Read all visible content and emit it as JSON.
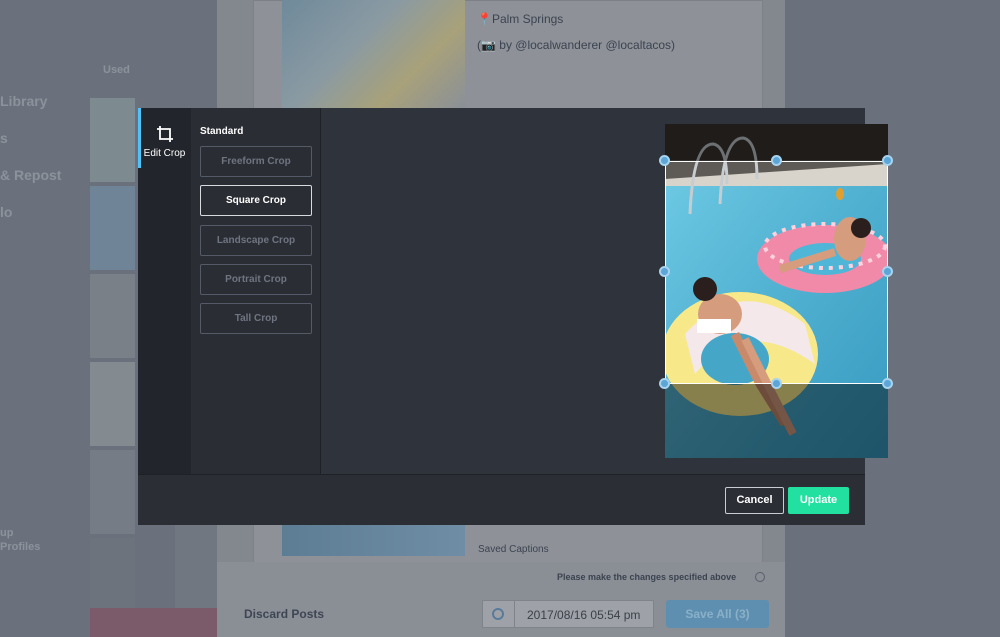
{
  "background": {
    "sidebar_labels": [
      "Library",
      "s",
      "& Repost",
      "lo",
      "up",
      "Profiles"
    ],
    "filter_value": "Used",
    "post_location": "📍Palm Springs",
    "post_credit": "(📷 by @localwanderer @localtacos)",
    "saved_captions": "Saved Captions",
    "warning": "Please make the changes specified above",
    "discard_label": "Discard Posts",
    "datetime": "2017/08/16 05:54 pm",
    "save_all_label": "Save All (3)"
  },
  "modal": {
    "tool_label": "Edit Crop",
    "section_heading": "Standard",
    "crop_options": [
      {
        "label": "Freeform Crop",
        "active": false
      },
      {
        "label": "Square Crop",
        "active": true
      },
      {
        "label": "Landscape Crop",
        "active": false
      },
      {
        "label": "Portrait Crop",
        "active": false
      },
      {
        "label": "Tall Crop",
        "active": false
      }
    ],
    "cancel_label": "Cancel",
    "update_label": "Update"
  },
  "colors": {
    "accent": "#4fc3f7",
    "update": "#22e0a0",
    "handle": "#5ba6d6"
  },
  "icons": {
    "tool": "crop-icon",
    "warning": "info-icon",
    "date": "clock-icon"
  }
}
